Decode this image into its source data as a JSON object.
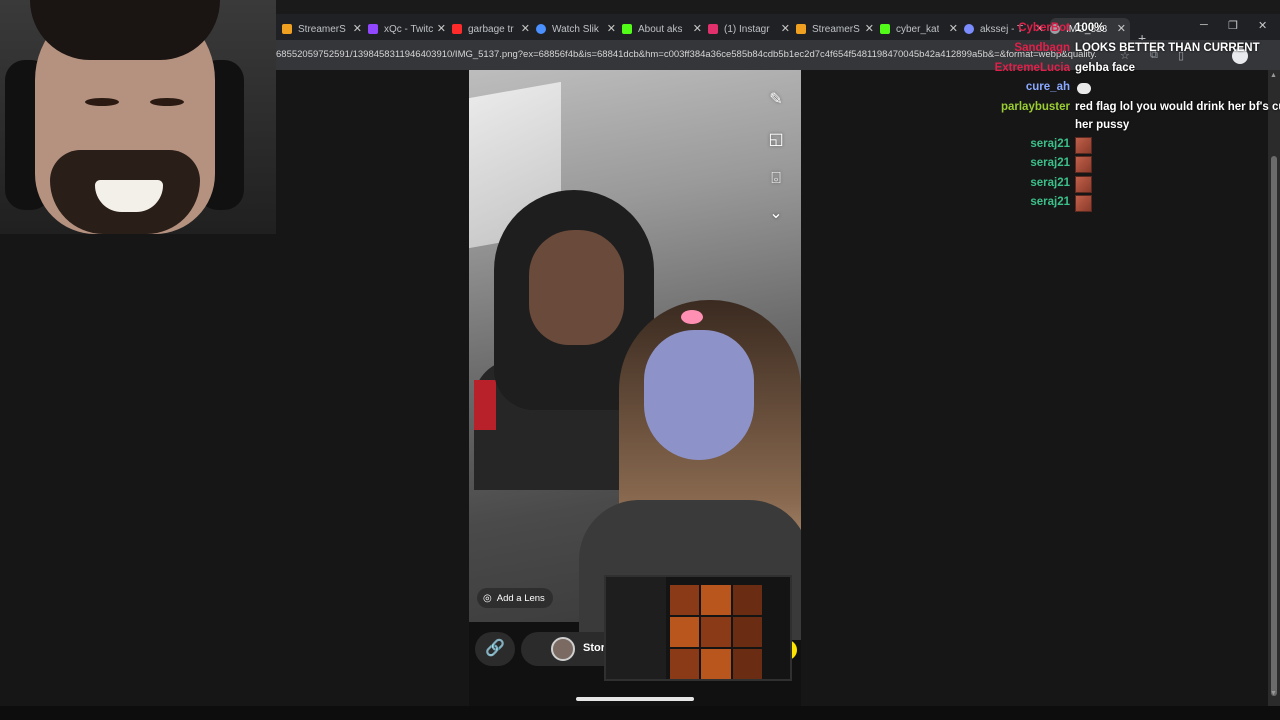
{
  "browser": {
    "tabs": [
      {
        "title": "StreamerS",
        "color": "#f0a020"
      },
      {
        "title": "xQc - Twitc",
        "color": "#9146ff"
      },
      {
        "title": "garbage tr",
        "color": "#ff2a2a"
      },
      {
        "title": "Watch Slik",
        "color": "#4a90ff"
      },
      {
        "title": "About aks",
        "color": "#53fc18"
      },
      {
        "title": "(1) Instagr",
        "color": "#e1306c"
      },
      {
        "title": "StreamerS",
        "color": "#f0a020"
      },
      {
        "title": "cyber_kat",
        "color": "#53fc18"
      },
      {
        "title": "akssej - T",
        "color": "#7b8cff"
      },
      {
        "title": "IMG_513",
        "color": "#9aa0a6"
      }
    ],
    "tab_close": "✕",
    "new_tab": "+",
    "window_controls": {
      "minimize": "─",
      "restore": "❐",
      "close": "✕"
    },
    "url": "68552059752591/1398458311946403910/IMG_5137.png?ex=68856f4b&is=68841dcb&hm=c003ff384a36ce585b84cdb5b1ec2d7c4f654f5481198470045b42a412899a5b&=&format=webp&quality..."
  },
  "snap": {
    "tools": {
      "pencil": "✎",
      "sticker": "◱",
      "camera": "⌻",
      "chevron": "⌄"
    },
    "lens_icon": "◎",
    "lens_label": "Add a Lens",
    "link_icon": "🔗",
    "story_label": "Stor"
  },
  "chat": {
    "messages": [
      {
        "user": "CyberBot",
        "color": "#e0204a",
        "text": "100%"
      },
      {
        "user": "Sandbagn",
        "color": "#e0204a",
        "text": "LOOKS BETTER THAN CURRENT"
      },
      {
        "user": "ExtremeLucia",
        "color": "#e0204a",
        "text": "gehba face"
      },
      {
        "user": "cure_ah",
        "color": "#8aa8ff",
        "text": "",
        "bubble": true
      },
      {
        "user": "parlaybuster",
        "color": "#9acd32",
        "text": "red flag lol you would drink her bf's cu"
      },
      {
        "user": "",
        "color": "#9acd32",
        "text": "her pussy"
      },
      {
        "user": "seraj21",
        "color": "#3cc08a",
        "text": "",
        "emote": true
      },
      {
        "user": "seraj21",
        "color": "#3cc08a",
        "text": "",
        "emote": true
      },
      {
        "user": "seraj21",
        "color": "#3cc08a",
        "text": "",
        "emote": true
      },
      {
        "user": "seraj21",
        "color": "#3cc08a",
        "text": "",
        "emote": true
      }
    ]
  }
}
